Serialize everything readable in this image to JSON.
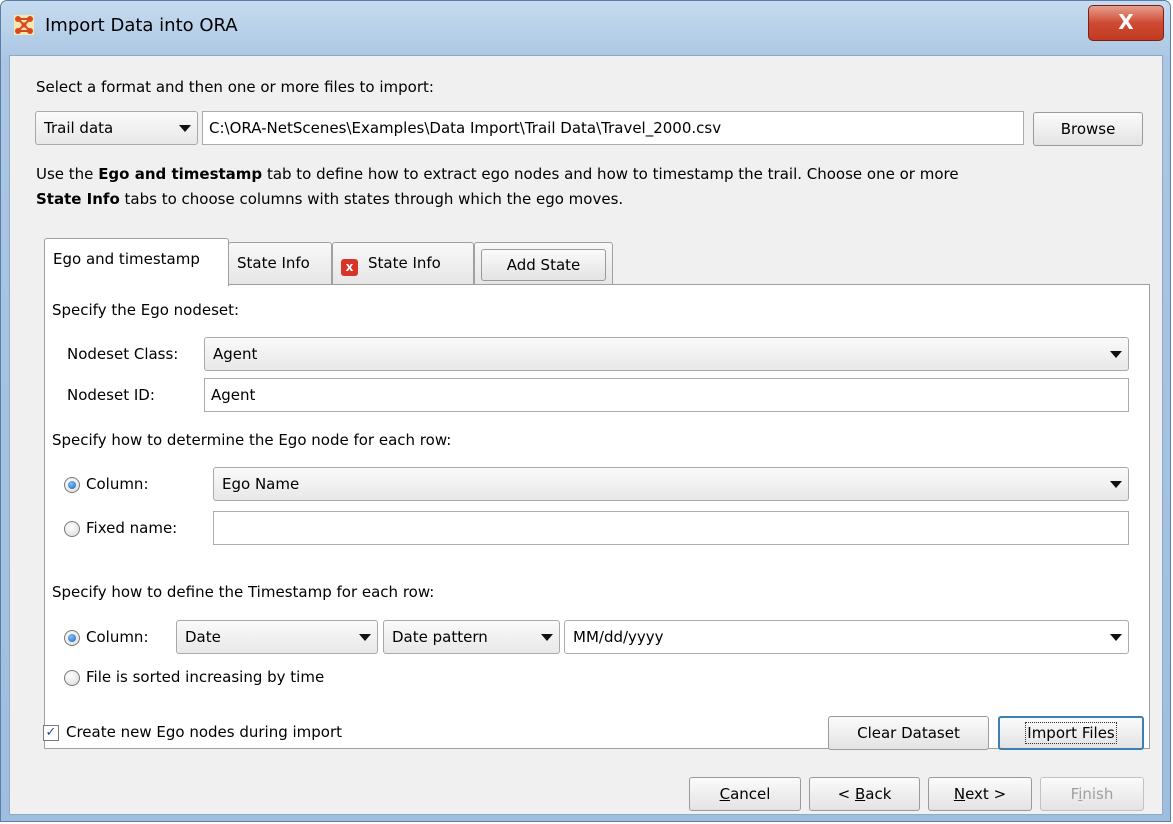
{
  "window": {
    "title": "Import Data into ORA",
    "close_glyph": "X"
  },
  "format": {
    "prompt": "Select a format and then one or more files to import:",
    "selected_format": "Trail data",
    "file_path": "C:\\ORA-NetScenes\\Examples\\Data Import\\Trail Data\\Travel_2000.csv",
    "browse_label": "Browse"
  },
  "instructions": {
    "part1": "Use the ",
    "bold1": "Ego and timestamp",
    "part2": " tab to define how to extract ego nodes and how to timestamp the trail. Choose one or more",
    "bold2": "State Info",
    "part3": " tabs to choose columns with states through which the ego moves."
  },
  "tabs": [
    {
      "label": "Ego and timestamp",
      "active": true
    },
    {
      "label": "State Info"
    },
    {
      "label": "State Info",
      "closable": true,
      "close_glyph": "x"
    },
    {
      "label": "Add State"
    }
  ],
  "ego": {
    "nodeset_heading": "Specify the Ego nodeset:",
    "nodeset_class_label": "Nodeset Class:",
    "nodeset_class_value": "Agent",
    "nodeset_id_label": "Nodeset ID:",
    "nodeset_id_value": "Agent",
    "node_heading": "Specify how to determine the Ego node for each row:",
    "column_label": "Column:",
    "column_value": "Ego Name",
    "fixed_name_label": "Fixed name:",
    "fixed_name_value": ""
  },
  "timestamp": {
    "heading": "Specify how to define the Timestamp for each row:",
    "column_label": "Column:",
    "column_value": "Date",
    "pattern_type": "Date pattern",
    "pattern_value": "MM/dd/yyyy",
    "sorted_label": "File is sorted increasing by time"
  },
  "bottom": {
    "create_nodes_label": "Create new Ego nodes during import",
    "check_glyph": "✓",
    "clear_label": "Clear Dataset",
    "import_label": "Import Files"
  },
  "nav": {
    "cancel_mn": "C",
    "cancel_rest": "ancel",
    "back_pre": "< ",
    "back_mn": "B",
    "back_rest": "ack",
    "next_mn": "N",
    "next_rest": "ext >",
    "finish_pre": "F",
    "finish_mn": "i",
    "finish_rest": "nish"
  }
}
